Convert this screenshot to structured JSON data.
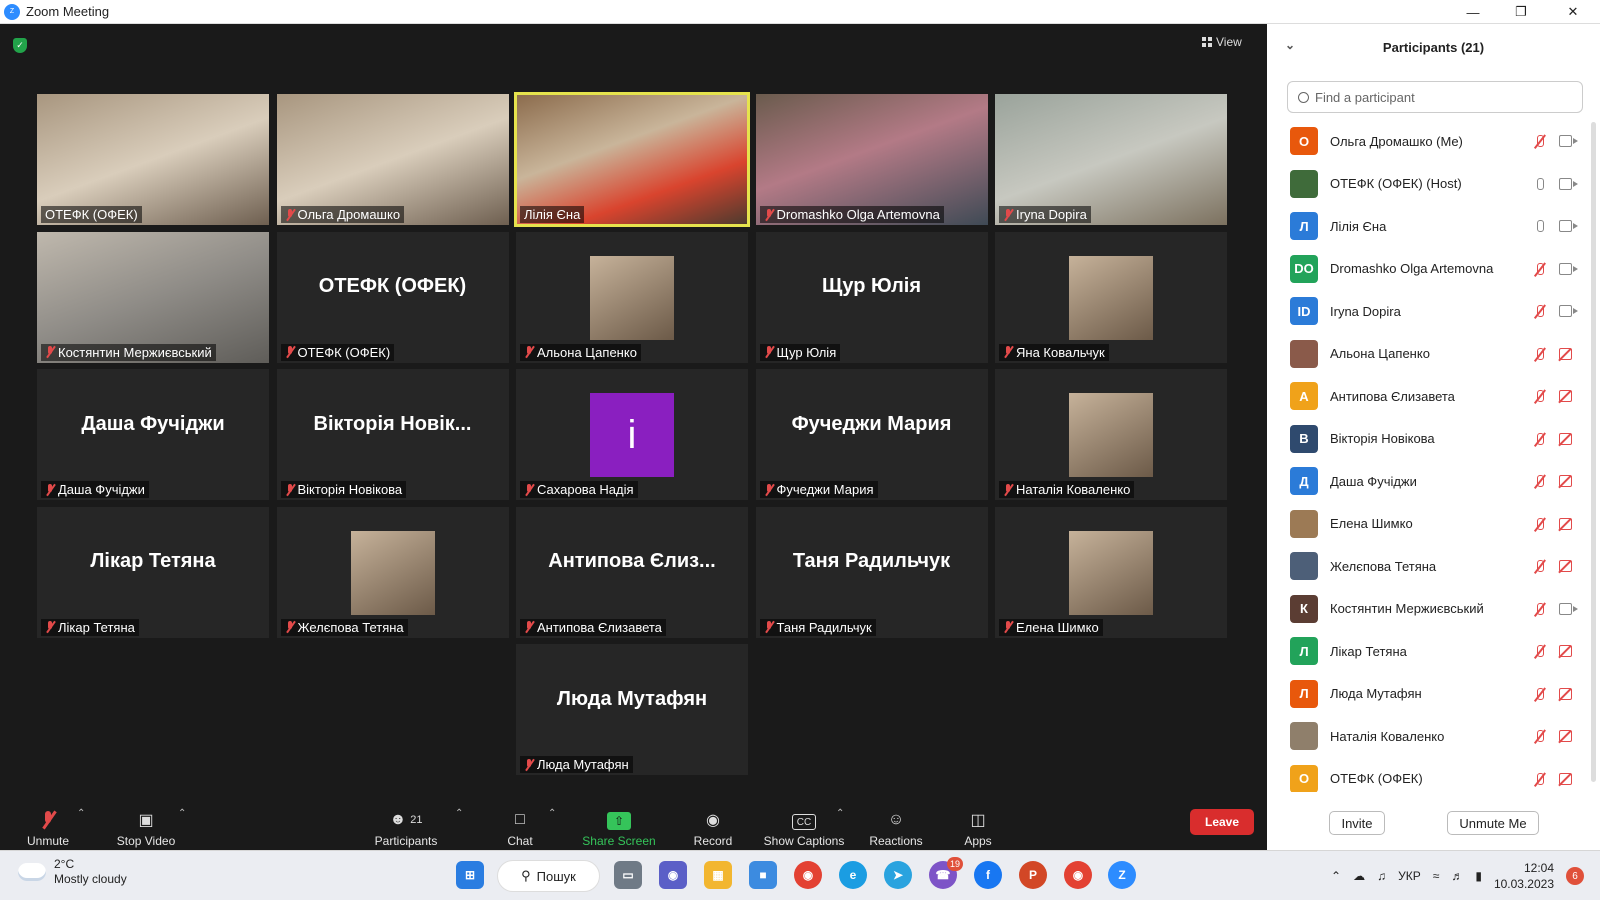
{
  "window": {
    "title": "Zoom Meeting",
    "app_icon": "zoom-icon"
  },
  "top": {
    "view_label": "View"
  },
  "tiles": [
    {
      "label": "ОТЕФК (ОФЕК)",
      "kind": "photo",
      "muted": false
    },
    {
      "label": "Ольга Дромашко",
      "kind": "photo",
      "muted": true
    },
    {
      "label": "Лілія Єна",
      "kind": "photo",
      "muted": false,
      "active": true
    },
    {
      "label": "Dromashko Olga Artemovna",
      "kind": "photo",
      "muted": true
    },
    {
      "label": "Iryna Dopira",
      "kind": "photo",
      "muted": true
    },
    {
      "label": "Костянтин Мержиєвський",
      "kind": "photo",
      "muted": true
    },
    {
      "label": "ОТЕФК (ОФЕК)",
      "kind": "name",
      "big": "ОТЕФК (ОФЕК)",
      "muted": true
    },
    {
      "label": "Альона Цапенко",
      "kind": "avatar",
      "muted": true
    },
    {
      "label": "Щур Юлія",
      "kind": "name",
      "big": "Щур Юлія",
      "muted": true
    },
    {
      "label": "Яна Ковальчук",
      "kind": "avatar",
      "muted": true
    },
    {
      "label": "Даша Фучіджи",
      "kind": "name",
      "big": "Даша Фучіджи",
      "muted": true
    },
    {
      "label": "Вікторія Новікова",
      "kind": "name",
      "big": "Вікторія Новік...",
      "muted": true
    },
    {
      "label": "Сахарова Надія",
      "kind": "letter",
      "letter": "i",
      "muted": true
    },
    {
      "label": "Фучеджи Мария",
      "kind": "name",
      "big": "Фучеджи Мария",
      "muted": true
    },
    {
      "label": "Наталія Коваленко",
      "kind": "avatar",
      "muted": true
    },
    {
      "label": "Лікар Тетяна",
      "kind": "name",
      "big": "Лікар Тетяна",
      "muted": true
    },
    {
      "label": "Желєпова Тетяна",
      "kind": "avatar",
      "muted": true
    },
    {
      "label": "Антипова Єлизавета",
      "kind": "name",
      "big": "Антипова Єлиз...",
      "muted": true
    },
    {
      "label": "Таня Радильчук",
      "kind": "name",
      "big": "Таня Радильчук",
      "muted": true
    },
    {
      "label": "Елена Шимко",
      "kind": "avatar",
      "muted": true
    },
    {
      "label": "Люда Мутафян",
      "kind": "name",
      "big": "Люда Мутафян",
      "muted": true
    }
  ],
  "toolbar": {
    "unmute": "Unmute",
    "stop_video": "Stop Video",
    "participants": "Participants",
    "participants_count": "21",
    "chat": "Chat",
    "share_screen": "Share Screen",
    "record": "Record",
    "show_captions": "Show Captions",
    "reactions": "Reactions",
    "apps": "Apps",
    "leave": "Leave"
  },
  "panel": {
    "title": "Participants (21)",
    "search_placeholder": "Find a participant",
    "invite": "Invite",
    "unmute_me": "Unmute Me",
    "participants": [
      {
        "initial": "О",
        "color": "#e8580c",
        "name": "Ольга Дромашко (Me)",
        "mic": "off",
        "cam": "on"
      },
      {
        "initial": "",
        "color": "#3f6b3a",
        "name": "ОТЕФК (ОФЕК) (Host)",
        "mic": "on",
        "cam": "on"
      },
      {
        "initial": "Л",
        "color": "#2b7bd8",
        "name": "Лілія Єна",
        "mic": "on",
        "cam": "on"
      },
      {
        "initial": "DO",
        "color": "#22a35a",
        "name": "Dromashko Olga Artemovna",
        "mic": "off",
        "cam": "on"
      },
      {
        "initial": "ID",
        "color": "#2b7bd8",
        "name": "Iryna Dopira",
        "mic": "off",
        "cam": "on"
      },
      {
        "initial": "",
        "color": "#8a5a4a",
        "name": "Альона Цапенко",
        "mic": "off",
        "cam": "off"
      },
      {
        "initial": "А",
        "color": "#f0a21a",
        "name": "Антипова Єлизавета",
        "mic": "off",
        "cam": "off"
      },
      {
        "initial": "В",
        "color": "#2f4a6e",
        "name": "Вікторія Новікова",
        "mic": "off",
        "cam": "off"
      },
      {
        "initial": "Д",
        "color": "#2b7bd8",
        "name": "Даша Фучіджи",
        "mic": "off",
        "cam": "off"
      },
      {
        "initial": "",
        "color": "#9c7a55",
        "name": "Елена Шимко",
        "mic": "off",
        "cam": "off"
      },
      {
        "initial": "",
        "color": "#4d5f78",
        "name": "Желєпова Тетяна",
        "mic": "off",
        "cam": "off"
      },
      {
        "initial": "К",
        "color": "#5b3d33",
        "name": "Костянтин Мержиєвський",
        "mic": "off",
        "cam": "on"
      },
      {
        "initial": "Л",
        "color": "#22a35a",
        "name": "Лікар Тетяна",
        "mic": "off",
        "cam": "off"
      },
      {
        "initial": "Л",
        "color": "#e8580c",
        "name": "Люда Мутафян",
        "mic": "off",
        "cam": "off"
      },
      {
        "initial": "",
        "color": "#8f7f6b",
        "name": "Наталія Коваленко",
        "mic": "off",
        "cam": "off"
      },
      {
        "initial": "О",
        "color": "#f0a21a",
        "name": "ОТЕФК (ОФЕК)",
        "mic": "off",
        "cam": "off"
      }
    ]
  },
  "taskbar": {
    "temp": "2°C",
    "weather": "Mostly cloudy",
    "search": "Пошук",
    "lang": "УКР",
    "time": "12:04",
    "date": "10.03.2023",
    "notif_count": "6",
    "viber_badge": "19"
  }
}
